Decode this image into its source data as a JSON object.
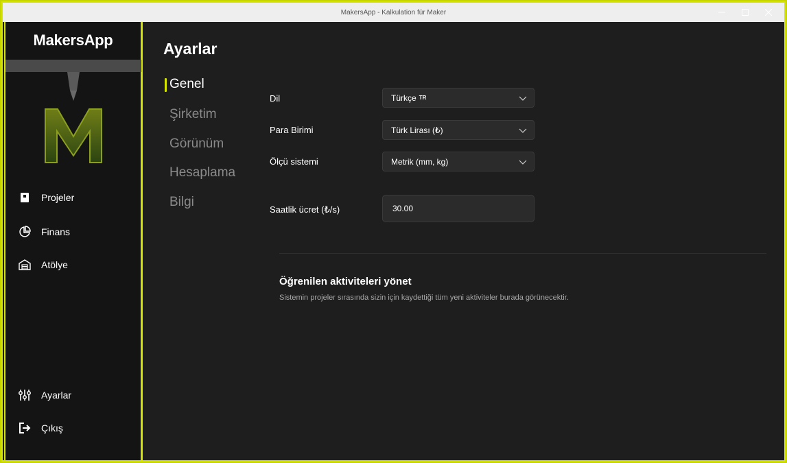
{
  "window": {
    "title": "MakersApp - Kalkulation für Maker"
  },
  "sidebar": {
    "brand": "MakersApp",
    "nav": [
      {
        "label": "Projeler",
        "icon": "book-icon"
      },
      {
        "label": "Finans",
        "icon": "pie-chart-icon"
      },
      {
        "label": "Atölye",
        "icon": "warehouse-icon"
      }
    ],
    "bottom": [
      {
        "label": "Ayarlar",
        "icon": "sliders-icon"
      },
      {
        "label": "Çıkış",
        "icon": "logout-icon"
      }
    ]
  },
  "page": {
    "title": "Ayarlar",
    "subnav": [
      "Genel",
      "Şirketim",
      "Görünüm",
      "Hesaplama",
      "Bilgi"
    ],
    "active_subnav": "Genel"
  },
  "settings": {
    "language": {
      "label": "Dil",
      "value": "Türkçe",
      "flag": "TR"
    },
    "currency": {
      "label": "Para Birimi",
      "value": "Türk Lirası (₺)"
    },
    "units": {
      "label": "Ölçü sistemi",
      "value": "Metrik (mm, kg)"
    },
    "hourly_rate": {
      "label": "Saatlik ücret (₺/s)",
      "value": "30.00"
    }
  },
  "learned": {
    "title": "Öğrenilen aktiviteleri yönet",
    "description": "Sistemin projeler sırasında sizin için kaydettiği tüm yeni aktiviteler burada görünecektir."
  },
  "colors": {
    "accent": "#d6e600",
    "background": "#1e1e1e",
    "sidebar": "#141414"
  }
}
